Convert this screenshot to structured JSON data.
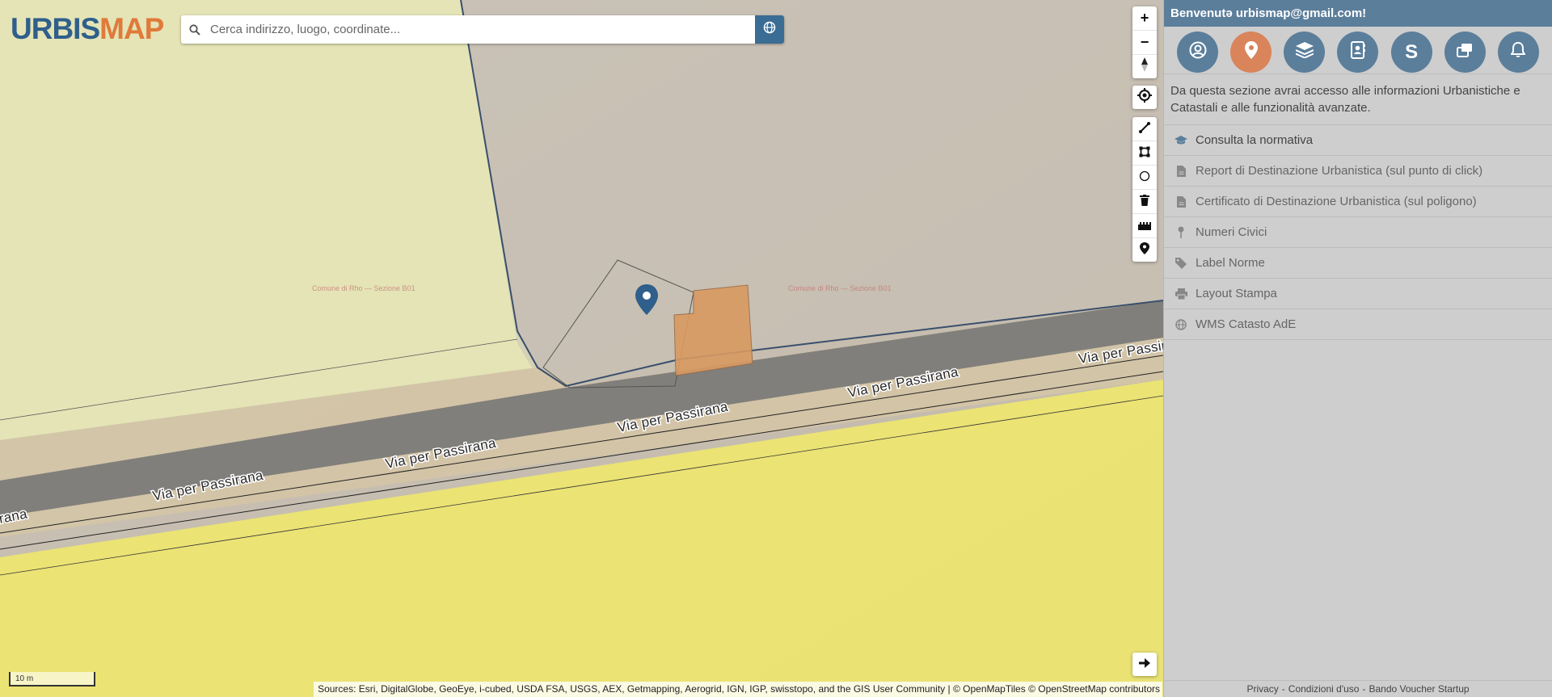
{
  "logo": {
    "part1": "URBIS",
    "part2": "MAP"
  },
  "search": {
    "placeholder": "Cerca indirizzo, luogo, coordinate..."
  },
  "map": {
    "road_labels": [
      "Via per Passirana",
      "Via per Passirana",
      "Via per Passirana",
      "Via per Passirana",
      "Via per Passira",
      "rana"
    ],
    "parcel_labels": [
      "Comune di Rho — Sezione B01",
      "Comune di Rho — Sezione B01"
    ],
    "scale_label": "10 m",
    "attribution": "Sources: Esri, DigitalGlobe, GeoEye, i-cubed, USDA FSA, USGS, AEX, Getmapping, Aerogrid, IGN, IGP, swisstopo, and the GIS User Community | © OpenMapTiles © OpenStreetMap contributors",
    "colors": {
      "zone_green": "#e6e7b6",
      "zone_yellow": "#eee66f",
      "building": "#d99a62",
      "marker": "#2f5f8a"
    }
  },
  "controls": {
    "zoom_in": "+",
    "zoom_out": "−",
    "icons": [
      "compass-icon",
      "locate-icon",
      "measure-line-icon",
      "measure-area-icon",
      "measure-circle-icon",
      "trash-icon",
      "ruler-icon",
      "pin-icon",
      "arrow-right-icon"
    ]
  },
  "sidebar": {
    "welcome": "Benvenutə urbismap@gmail.com!",
    "nav_icons": [
      "user-icon",
      "map-marker-icon",
      "layers-icon",
      "contact-book-icon",
      "s-icon",
      "windows-icon",
      "bell-icon"
    ],
    "s_label": "S",
    "intro": "Da questa sezione avrai accesso alle informazioni Urbanistiche e Catastali e alle funzionalità avanzate.",
    "items": [
      {
        "label": "Consulta la normativa",
        "icon": "graduation-cap-icon"
      },
      {
        "label": "Report di Destinazione Urbanistica (sul punto di click)",
        "icon": "file-icon"
      },
      {
        "label": "Certificato di Destinazione Urbanistica (sul poligono)",
        "icon": "file-icon"
      },
      {
        "label": "Numeri Civici",
        "icon": "map-pin-icon"
      },
      {
        "label": "Label Norme",
        "icon": "tag-icon"
      },
      {
        "label": "Layout Stampa",
        "icon": "printer-icon"
      },
      {
        "label": "WMS Catasto AdE",
        "icon": "globe-icon"
      }
    ],
    "footer": {
      "privacy": "Privacy",
      "terms": "Condizioni d'uso",
      "voucher": "Bando Voucher Startup",
      "separator": "-"
    }
  }
}
